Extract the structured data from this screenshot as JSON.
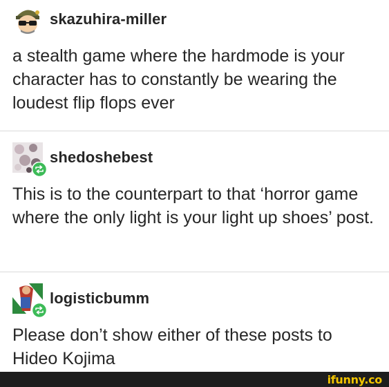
{
  "posts": [
    {
      "username": "skazuhira-miller",
      "text": "a stealth game where the hardmode is your character has to constantly be wearing the loudest flip flops ever"
    },
    {
      "username": "shedoshebest",
      "text": "This is to the counterpart to that ‘horror game where the only light is your light up shoes’ post."
    },
    {
      "username": "logisticbumm",
      "text": "Please don’t show either of these posts to Hideo Kojima"
    }
  ],
  "watermark": "ifunny.co",
  "colors": {
    "reblog_badge": "#3dbb58",
    "watermark": "#f2c400",
    "footer_bar": "#1d1d1d"
  }
}
